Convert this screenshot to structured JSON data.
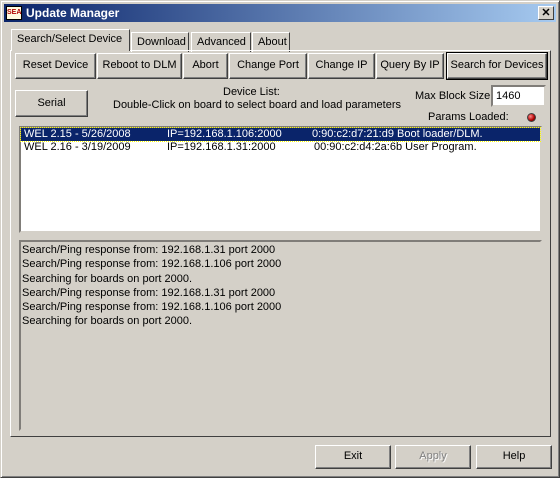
{
  "window": {
    "title": "Update Manager",
    "icon_text": "SEA"
  },
  "tabs": [
    {
      "label": "Search/Select Device"
    },
    {
      "label": "Download"
    },
    {
      "label": "Advanced"
    },
    {
      "label": "About"
    }
  ],
  "toolbar": {
    "reset_device": "Reset Device",
    "reboot_dlm": "Reboot to DLM",
    "abort": "Abort",
    "change_port": "Change Port",
    "change_ip": "Change IP",
    "query_by_ip": "Query By IP",
    "search_devices": "Search for Devices"
  },
  "serial_button": "Serial",
  "device_list": {
    "heading": "Device List:",
    "instruction": "Double-Click on board to select board and load parameters",
    "rows": [
      {
        "version": "WEL 2.15 - 5/26/2008",
        "ip": "IP=192.168.1.106:2000",
        "info": "0:90:c2:d7:21:d9 Boot loader/DLM."
      },
      {
        "version": "WEL 2.16 - 3/19/2009",
        "ip": "IP=192.168.1.31:2000",
        "info": "00:90:c2:d4:2a:6b User Program."
      }
    ]
  },
  "max_block": {
    "label": "Max Block Size",
    "value": "1460"
  },
  "params_loaded": {
    "label": "Params Loaded:"
  },
  "log_lines": [
    "Search/Ping response from: 192.168.1.31 port 2000",
    "Search/Ping response from: 192.168.1.106 port 2000",
    "Searching for boards on port 2000.",
    "Search/Ping response from: 192.168.1.31 port 2000",
    "Search/Ping response from: 192.168.1.106 port 2000",
    "Searching for boards on port 2000."
  ],
  "footer": {
    "exit": "Exit",
    "apply": "Apply",
    "help": "Help"
  },
  "colors": {
    "title_bar": "#0a246a",
    "selection": "#0a246a",
    "led": "#b00000"
  }
}
